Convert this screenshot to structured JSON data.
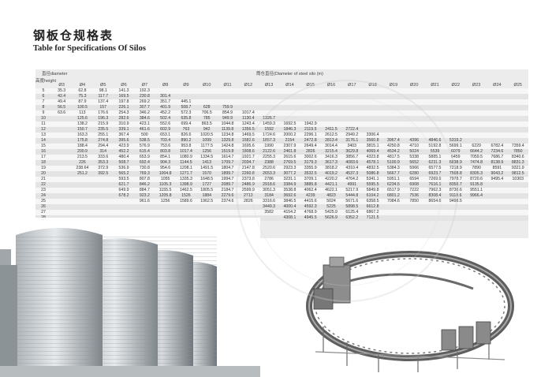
{
  "title": {
    "cn": "钢板仓规格表",
    "en": "Table for Specifications Of Silos"
  },
  "header": {
    "diameter_label": "直径diameter",
    "height_label": "高度height",
    "main_label": "筒仓直径(Diameter of steel silo (m)"
  },
  "diameters": [
    "Ø3",
    "Ø4",
    "Ø5",
    "Ø6",
    "Ø7",
    "Ø8",
    "Ø9",
    "Ø10",
    "Ø11",
    "Ø12",
    "Ø13",
    "Ø14",
    "Ø15",
    "Ø16",
    "Ø17",
    "Ø18",
    "Ø19",
    "Ø20",
    "Ø21",
    "Ø22",
    "Ø23",
    "Ø24",
    "Ø25"
  ],
  "rows": [
    [
      "5",
      "35.3",
      "62.8",
      "98.1",
      "141.3",
      "192.3",
      "",
      "",
      "",
      "",
      "",
      "",
      "",
      "",
      "",
      "",
      "",
      "",
      "",
      "",
      "",
      "",
      "",
      ""
    ],
    [
      "6",
      "42.4",
      "75.3",
      "117.7",
      "169.5",
      "230.8",
      "301.4",
      "",
      "",
      "",
      "",
      "",
      "",
      "",
      "",
      "",
      "",
      "",
      "",
      "",
      "",
      "",
      "",
      ""
    ],
    [
      "7",
      "49.4",
      "87.9",
      "137.4",
      "197.8",
      "269.2",
      "351.7",
      "445.1",
      "",
      "",
      "",
      "",
      "",
      "",
      "",
      "",
      "",
      "",
      "",
      "",
      "",
      "",
      "",
      ""
    ],
    [
      "8",
      "56.5",
      "100.5",
      "157",
      "226.1",
      "307.7",
      "401.9",
      "508.7",
      "628",
      "759.9",
      "",
      "",
      "",
      "",
      "",
      "",
      "",
      "",
      "",
      "",
      "",
      "",
      "",
      ""
    ],
    [
      "9",
      "63.6",
      "113",
      "176.6",
      "254.3",
      "346.2",
      "452.2",
      "572.3",
      "706.5",
      "854.9",
      "1017.4",
      "",
      "",
      "",
      "",
      "",
      "",
      "",
      "",
      "",
      "",
      "",
      "",
      ""
    ],
    [
      "10",
      "",
      "125.6",
      "196.3",
      "282.6",
      "384.6",
      "502.4",
      "635.8",
      "785",
      "949.9",
      "1130.4",
      "1326.7",
      "",
      "",
      "",
      "",
      "",
      "",
      "",
      "",
      "",
      "",
      "",
      ""
    ],
    [
      "11",
      "",
      "138.2",
      "215.9",
      "310.9",
      "423.1",
      "552.6",
      "699.4",
      "863.5",
      "1044.8",
      "1243.4",
      "1459.3",
      "1692.5",
      "1942.9",
      "",
      "",
      "",
      "",
      "",
      "",
      "",
      "",
      "",
      ""
    ],
    [
      "12",
      "",
      "150.7",
      "235.5",
      "339.1",
      "461.6",
      "602.9",
      "763",
      "942",
      "1139.8",
      "1356.5",
      "1592",
      "1846.3",
      "2119.5",
      "2411.5",
      "2722.4",
      "",
      "",
      "",
      "",
      "",
      "",
      "",
      ""
    ],
    [
      "13",
      "",
      "163.3",
      "255.1",
      "367.4",
      "500",
      "653.1",
      "826.6",
      "1020.5",
      "1234.8",
      "1469.5",
      "1724.6",
      "2000.2",
      "2296.1",
      "2612.5",
      "2949.2",
      "3306.4",
      "",
      "",
      "",
      "",
      "",
      "",
      ""
    ],
    [
      "14",
      "",
      "175.8",
      "274.8",
      "395.6",
      "538.5",
      "703.4",
      "890.2",
      "1099",
      "1329.8",
      "1582.6",
      "1857.3",
      "2154",
      "2472.8",
      "2813.4",
      "3176.1",
      "3560.8",
      "3967.4",
      "4396",
      "4846.6",
      "5319.2",
      "",
      "",
      ""
    ],
    [
      "15",
      "",
      "188.4",
      "294.4",
      "423.9",
      "576.9",
      "753.6",
      "953.8",
      "1177.5",
      "1424.8",
      "1695.6",
      "1990",
      "2307.9",
      "2649.4",
      "3014.4",
      "3403",
      "3815.1",
      "4250.8",
      "4710",
      "5192.8",
      "5699.1",
      "6229",
      "6782.4",
      "7359.4"
    ],
    [
      "16",
      "",
      "200.9",
      "314",
      "452.2",
      "615.4",
      "803.8",
      "1017.4",
      "1256",
      "1519.8",
      "1808.6",
      "2122.6",
      "2461.8",
      "2826",
      "3215.4",
      "3629.8",
      "4069.4",
      "4534.2",
      "5024",
      "5539",
      "6079",
      "6644.2",
      "7234.6",
      "7850"
    ],
    [
      "17",
      "",
      "213.5",
      "333.6",
      "480.4",
      "653.9",
      "854.1",
      "1080.9",
      "1334.5",
      "1614.7",
      "1921.7",
      "2255.3",
      "2615.6",
      "3002.6",
      "3416.3",
      "3856.7",
      "4323.8",
      "4817.5",
      "5338",
      "5885.1",
      "6459",
      "7059.5",
      "7686.7",
      "8340.6"
    ],
    [
      "18",
      "",
      "226",
      "353.3",
      "508.7",
      "692.4",
      "904.3",
      "1144.5",
      "1413",
      "1709.7",
      "2034.7",
      "2388",
      "2769.5",
      "3179.3",
      "3617.3",
      "4083.6",
      "4578.1",
      "5100.9",
      "5652",
      "6231.3",
      "6838.9",
      "7474.8",
      "8138.9",
      "8831.3"
    ],
    [
      "19",
      "",
      "238.64",
      "372.9",
      "536.9",
      "730.8",
      "954.6",
      "1208.1",
      "1491.5",
      "1804.7",
      "2147.8",
      "2520.6",
      "2923.3",
      "3355.9",
      "3818.2",
      "4310.4",
      "4832.5",
      "5384.3",
      "5966",
      "6577.5",
      "7218.9",
      "7890",
      "8591",
      "9321.9"
    ],
    [
      "20",
      "",
      "251.2",
      "392.5",
      "565.2",
      "769.3",
      "1004.8",
      "1271.7",
      "1570",
      "1899.7",
      "2260.8",
      "2653.3",
      "3077.2",
      "3532.5",
      "4019.2",
      "4537.3",
      "5086.8",
      "5667.7",
      "6280",
      "6923.7",
      "7598.8",
      "8305.3",
      "9043.2",
      "9812.5"
    ],
    [
      "21",
      "",
      "",
      "",
      "593.5",
      "807.8",
      "1055",
      "1335.3",
      "1648.5",
      "1994.7",
      "2373.8",
      "2786",
      "3231.1",
      "3709.1",
      "4220.2",
      "4764.2",
      "5341.1",
      "5951.1",
      "6594",
      "7269.9",
      "7978.7",
      "8720.6",
      "9495.4",
      "10303"
    ],
    [
      "22",
      "",
      "",
      "",
      "621.7",
      "846.2",
      "1105.3",
      "1398.9",
      "1727",
      "2089.7",
      "2486.9",
      "2918.6",
      "3384.9",
      "3885.8",
      "4421.1",
      "4991",
      "5595.5",
      "6234.5",
      "6908",
      "7616.1",
      "8358.7",
      "9135.8",
      "",
      ""
    ],
    [
      "23",
      "",
      "",
      "",
      "649.9",
      "884.7",
      "1155.5",
      "1462.5",
      "1805.5",
      "2184.7",
      "2599.9",
      "3051.3",
      "3538.8",
      "4062.4",
      "4622.1",
      "5217.9",
      "5849.8",
      "6517.9",
      "7222",
      "7962.3",
      "8738.6",
      "9551.1",
      "",
      ""
    ],
    [
      "24",
      "",
      "",
      "",
      "678.2",
      "923.2",
      "1205.8",
      "1526",
      "1884",
      "2279.6",
      "2713",
      "3184",
      "3692.6",
      "4239",
      "4823",
      "5444.8",
      "6104.2",
      "6801.2",
      "7536",
      "8308.4",
      "9118.6",
      "9966.4",
      "",
      ""
    ],
    [
      "25",
      "",
      "",
      "",
      "",
      "961.6",
      "1256",
      "1589.6",
      "1962.5",
      "2374.6",
      "2826",
      "3316.6",
      "3846.5",
      "4415.6",
      "5024",
      "5671.6",
      "6358.5",
      "7084.6",
      "7850",
      "8654.6",
      "9498.5",
      "",
      "",
      ""
    ],
    [
      "26",
      "",
      "",
      "",
      "",
      "",
      "",
      "",
      "",
      "",
      "",
      "3449.3",
      "4000.4",
      "4592.3",
      "5225",
      "5898.5",
      "6612.8",
      "",
      "",
      "",
      "",
      "",
      "",
      ""
    ],
    [
      "27",
      "",
      "",
      "",
      "",
      "",
      "",
      "",
      "",
      "",
      "",
      "3582",
      "4154.2",
      "4768.9",
      "5425.9",
      "6125.4",
      "6867.2",
      "",
      "",
      "",
      "",
      "",
      "",
      ""
    ],
    [
      "28",
      "",
      "",
      "",
      "",
      "",
      "",
      "",
      "",
      "",
      "",
      "",
      "4308.1",
      "4945.5",
      "5626.9",
      "6352.2",
      "7121.5",
      "",
      "",
      "",
      "",
      "",
      "",
      ""
    ]
  ],
  "colors": {
    "table_bg": "#ececec",
    "row_light": "#f6f6f6",
    "row_dark": "#e4e4e4",
    "silo_light": "#d9dde0",
    "silo_dark": "#8a9196",
    "steel_frame": "#6d6d6d"
  }
}
